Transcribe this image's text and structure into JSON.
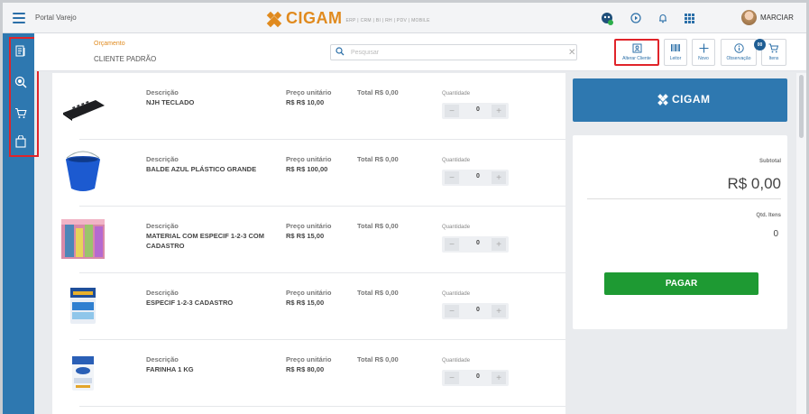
{
  "topbar": {
    "portal_title": "Portal Varejo",
    "brand_name": "CIGAM",
    "brand_sub": "ERP | CRM | BI | RH | PDV | MOBILE",
    "username": "MARCIAR"
  },
  "sidebar": {
    "items": [
      {
        "icon": "document-list-icon"
      },
      {
        "icon": "search-badge-icon"
      },
      {
        "icon": "cart-icon"
      },
      {
        "icon": "shopping-bag-icon"
      }
    ]
  },
  "header": {
    "doc_type": "Orçamento",
    "customer": "CLIENTE PADRÃO",
    "search_placeholder": "Pesquisar"
  },
  "toolbar": {
    "change_customer_label": "Alterar Cliente",
    "reader_label": "Leitor",
    "new_label": "Novo",
    "note_label": "Observação",
    "items_label": "Itens",
    "items_badge": "00"
  },
  "labels": {
    "description": "Descrição",
    "unit_price": "Preço unitário",
    "quantity": "Quantidade"
  },
  "products": [
    {
      "name": "NJH TECLADO",
      "unit_price": "R$ R$ 10,00",
      "total": "Total R$ 0,00",
      "qty": "0"
    },
    {
      "name": "BALDE AZUL PLÁSTICO GRANDE",
      "unit_price": "R$ R$ 100,00",
      "total": "Total R$ 0,00",
      "qty": "0"
    },
    {
      "name": "MATERIAL COM ESPECIF 1-2-3 COM CADASTRO",
      "unit_price": "R$ R$ 15,00",
      "total": "Total R$ 0,00",
      "qty": "0"
    },
    {
      "name": "ESPECIF 1-2-3 CADASTRO",
      "unit_price": "R$ R$ 15,00",
      "total": "Total R$ 0,00",
      "qty": "0"
    },
    {
      "name": "FARINHA 1 KG",
      "unit_price": "R$ R$ 80,00",
      "total": "Total R$ 0,00",
      "qty": "0"
    }
  ],
  "summary": {
    "brand": "CIGAM",
    "subtotal_label": "Subtotal",
    "subtotal_value": "R$ 0,00",
    "qty_items_label": "Qtd. Itens",
    "qty_items_value": "0",
    "pay_label": "PAGAR"
  },
  "colors": {
    "accent": "#2e78b0",
    "brand_orange": "#e08a1e",
    "pay_green": "#1e9a33",
    "highlight_red": "#e0242a"
  }
}
